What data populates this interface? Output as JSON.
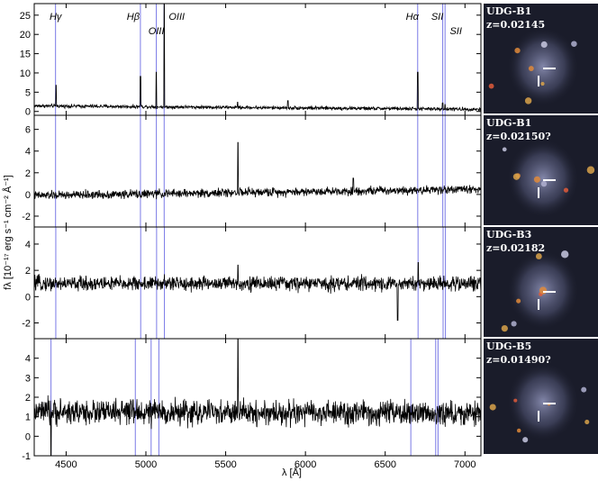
{
  "chart_data": {
    "type": "line",
    "xlabel": "λ [Å]",
    "ylabel": "fλ [10⁻¹⁷ erg s⁻¹ cm⁻² Å⁻¹]",
    "xlim": [
      4300,
      7100
    ],
    "xticks": [
      4500,
      5000,
      5500,
      6000,
      6500,
      7000
    ],
    "emission_lines": [
      {
        "label": "Hγ",
        "rest": 4340.5
      },
      {
        "label": "Hβ",
        "rest": 4861.3
      },
      {
        "label": "OIII",
        "rest": 4958.9
      },
      {
        "label": "OIII",
        "rest": 5006.8
      },
      {
        "label": "Hα",
        "rest": 6562.8
      },
      {
        "label": "SII",
        "rest": 6716.4
      },
      {
        "label": "SII",
        "rest": 6730.8
      }
    ],
    "panels": [
      {
        "ylim": [
          -1,
          28
        ],
        "yticks": [
          0,
          5,
          10,
          15,
          20,
          25
        ],
        "base": 1.0,
        "noise": 0.35,
        "slope": -0.9,
        "line_shift": 0.02145,
        "spikes": [
          {
            "x": 4437,
            "y": 6.8
          },
          {
            "x": 4966,
            "y": 9.1
          },
          {
            "x": 5065,
            "y": 10.2
          },
          {
            "x": 5115,
            "y": 27.8
          },
          {
            "x": 5575,
            "y": 2.4
          },
          {
            "x": 5890,
            "y": 2.8
          },
          {
            "x": 6704,
            "y": 10.2
          },
          {
            "x": 6860,
            "y": 2.2
          },
          {
            "x": 6875,
            "y": 1.8
          }
        ],
        "image": {
          "name": "UDG-B1",
          "z": "z=0.02145"
        }
      },
      {
        "ylim": [
          -3,
          7.3
        ],
        "yticks": [
          -2,
          0,
          2,
          4,
          6
        ],
        "base": 0.2,
        "noise": 0.3,
        "slope": 0.6,
        "line_shift": 0.0215,
        "spikes": [
          {
            "x": 5577,
            "y": 4.8
          },
          {
            "x": 6300,
            "y": 1.5
          }
        ],
        "image": {
          "name": "UDG-B1",
          "z": "z=0.02150?"
        }
      },
      {
        "ylim": [
          -3.2,
          5.3
        ],
        "yticks": [
          -2,
          0,
          2,
          4
        ],
        "base": 1.0,
        "noise": 0.42,
        "slope": 0.0,
        "line_shift": 0.02182,
        "spikes": [
          {
            "x": 5577,
            "y": 2.4
          },
          {
            "x": 6578,
            "y": -1.8
          },
          {
            "x": 6707,
            "y": 2.6
          }
        ],
        "image": {
          "name": "UDG-B3",
          "z": "z=0.02182"
        }
      },
      {
        "ylim": [
          -1,
          5
        ],
        "yticks": [
          -1,
          0,
          1,
          2,
          3,
          4
        ],
        "base": 1.2,
        "noise": 0.48,
        "slope": -0.1,
        "line_shift": 0.0149,
        "spikes": [
          {
            "x": 5577,
            "y": 5.0
          },
          {
            "x": 4405,
            "y": -1.0
          }
        ],
        "image": {
          "name": "UDG-B5",
          "z": "z=0.01490?"
        }
      }
    ],
    "colors": {
      "spectrum": "#000000",
      "line_marker": "#7a7ae6",
      "image_bg": "#1a1c2a"
    }
  }
}
